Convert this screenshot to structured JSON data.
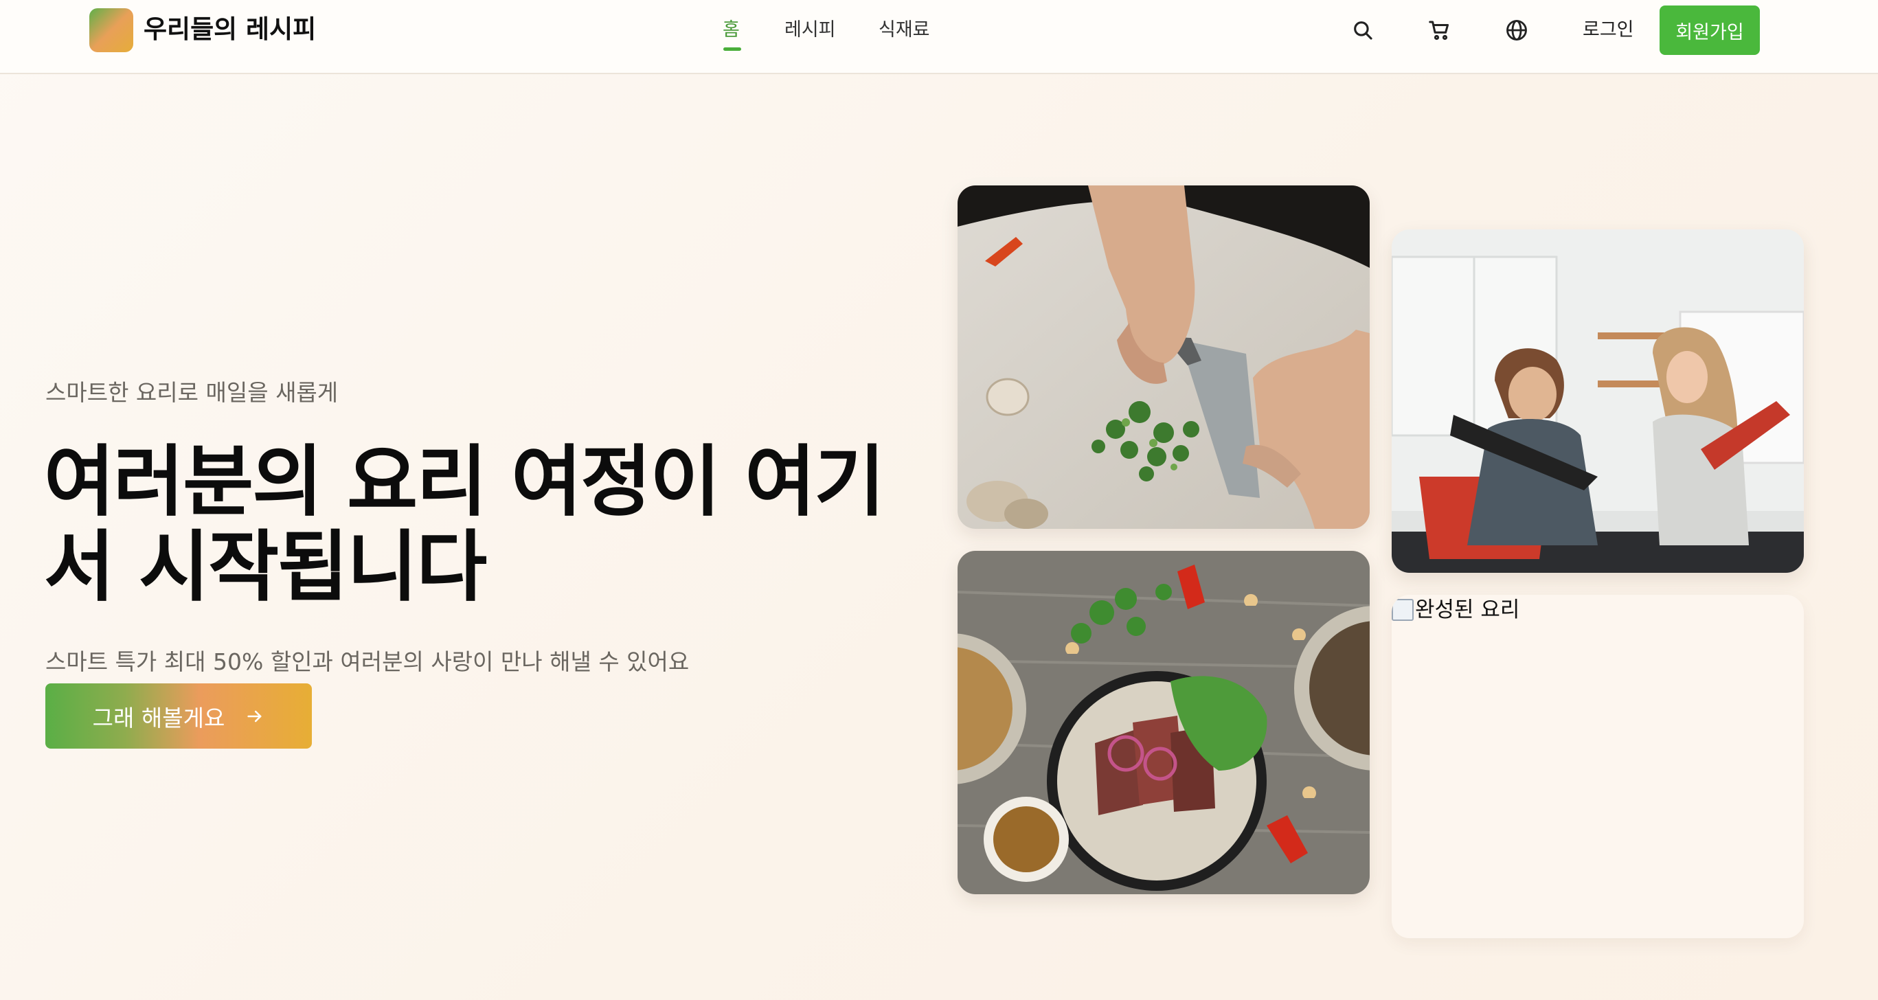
{
  "header": {
    "logo_text": "우리들의 레시피",
    "nav": [
      {
        "label": "홈",
        "active": true
      },
      {
        "label": "레시피",
        "active": false
      },
      {
        "label": "식재료",
        "active": false
      }
    ],
    "icons": [
      "search-icon",
      "cart-icon",
      "globe-icon"
    ],
    "login_label": "로그인",
    "signup_label": "회원가입"
  },
  "hero": {
    "eyebrow": "스마트한 요리로 매일을 새롭게",
    "title": "여러분의 요리 여정이 여기서 시작됩니다",
    "subtitle": "스마트 특가 최대 50% 할인과 여러분의 사랑이 만나 해낼 수 있어요",
    "cta_label": "그래 해볼게요",
    "cta_icon": "arrow-right-icon"
  },
  "gallery": {
    "broken_image_alt": "완성된 요리"
  },
  "colors": {
    "accent_green": "#4ab83c",
    "accent_orange": "#e7ae35",
    "background": "#fbf3ea"
  }
}
